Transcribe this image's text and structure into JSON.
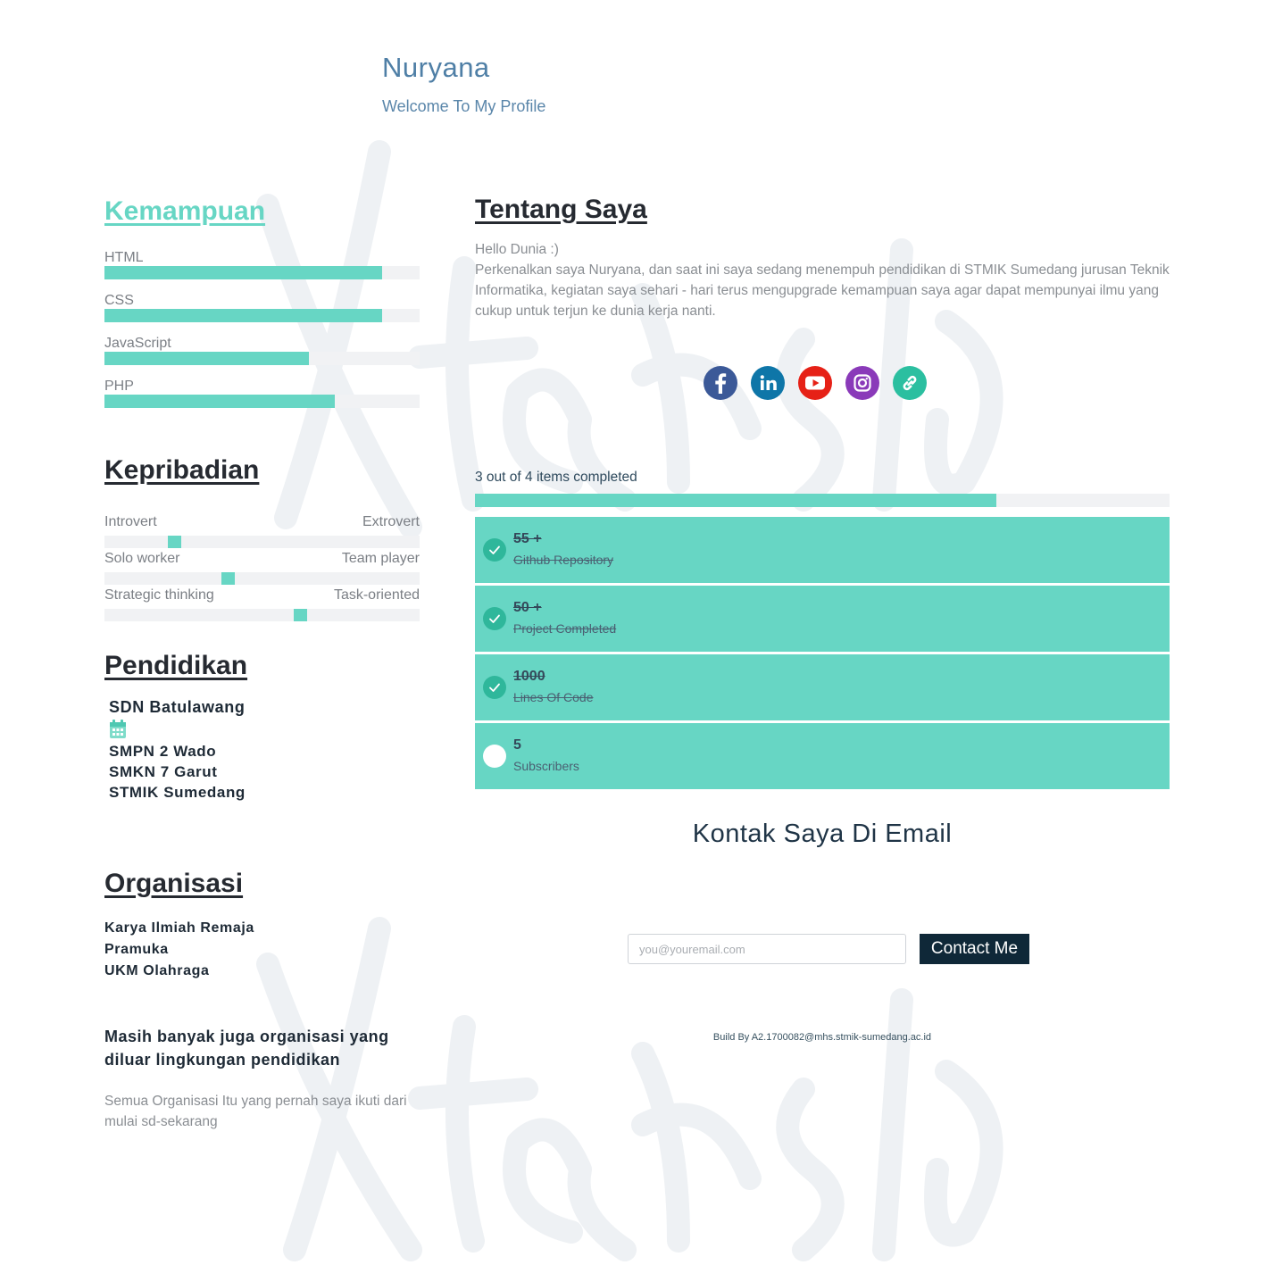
{
  "header": {
    "name": "Nuryana",
    "subtitle": "Welcome To My Profile"
  },
  "skills": {
    "title": "Kemampuan",
    "items": [
      {
        "label": "HTML",
        "level": 0.88
      },
      {
        "label": "CSS",
        "level": 0.88
      },
      {
        "label": "JavaScript",
        "level": 0.65
      },
      {
        "label": "PHP",
        "level": 0.73
      }
    ]
  },
  "personality": {
    "title": "Kepribadian",
    "items": [
      {
        "left": "Introvert",
        "right": "Extrovert",
        "value": 0.22
      },
      {
        "left": "Solo worker",
        "right": "Team player",
        "value": 0.39
      },
      {
        "left": "Strategic thinking",
        "right": "Task-oriented",
        "value": 0.62
      }
    ]
  },
  "education": {
    "title": "Pendidikan",
    "items": [
      "SDN Batulawang",
      "SMPN 2 Wado",
      "SMKN 7 Garut",
      "STMIK Sumedang"
    ]
  },
  "organization": {
    "title": "Organisasi",
    "items": [
      "Karya Ilmiah Remaja",
      "Pramuka",
      "UKM Olahraga"
    ],
    "note_heading": "Masih banyak juga organisasi yang diluar lingkungan pendidikan",
    "note_text": "Semua Organisasi Itu yang pernah saya ikuti dari mulai sd-sekarang"
  },
  "about": {
    "title": "Tentang Saya",
    "greeting": "Hello Dunia :)",
    "body": "Perkenalkan saya Nuryana, dan saat ini saya sedang menempuh pendidikan di STMIK Sumedang jurusan Teknik Informatika, kegiatan saya sehari - hari terus mengupgrade kemampuan saya agar dapat mempunyai ilmu yang cukup untuk terjun ke dunia kerja nanti."
  },
  "socials": [
    {
      "icon": "facebook-icon",
      "color": "#3b5998"
    },
    {
      "icon": "linkedin-icon",
      "color": "#0e76a8"
    },
    {
      "icon": "youtube-icon",
      "color": "#e62117"
    },
    {
      "icon": "instagram-icon",
      "color": "#8a3ab9"
    },
    {
      "icon": "link-icon",
      "color": "#2bbfa0"
    }
  ],
  "progress": {
    "text": "3 out of 4 items completed",
    "fraction": 0.75
  },
  "tasks": [
    {
      "number": "55 +",
      "label": "Github Repository",
      "done": true
    },
    {
      "number": "50 +",
      "label": "Project Completed",
      "done": true
    },
    {
      "number": "1000",
      "label": "Lines Of Code",
      "done": true
    },
    {
      "number": "5",
      "label": "Subscribers",
      "done": false
    }
  ],
  "contact": {
    "title": "Kontak Saya Di Email",
    "placeholder": "you@youremail.com",
    "button": "Contact Me"
  },
  "footer": {
    "text": "Build By A2.1700082@mhs.stmik-sumedang.ac.id"
  },
  "colors": {
    "accent": "#67d6c4",
    "dark": "#0f2838",
    "header_blue": "#4f7fa6"
  }
}
